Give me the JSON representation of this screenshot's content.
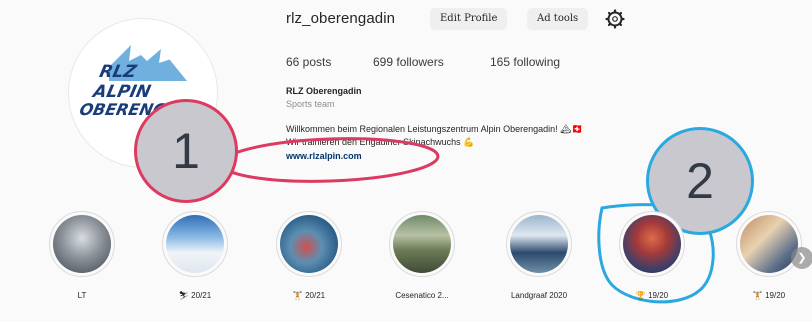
{
  "profile": {
    "username": "rlz_oberengadin",
    "edit_profile_label": "Edit Profile",
    "ad_tools_label": "Ad tools",
    "settings_icon": "gear-icon",
    "avatar_text": [
      "RLZ",
      "ALPIN",
      "OBERENGA"
    ]
  },
  "stats": {
    "posts": "66 posts",
    "followers": "699 followers",
    "following": "165 following"
  },
  "bio": {
    "name": "RLZ Oberengadin",
    "category": "Sports team",
    "line1": "Willkommen beim Regionalen Leistungszentrum Alpin Oberengadin! 🏔🇨🇭",
    "line2": "Wir trainieren den Engadiner Skinachwuchs 💪",
    "link": "www.rlzalpin.com"
  },
  "annotations": {
    "callout_1": "1",
    "callout_2": "2",
    "callout_1_color": "#dc3a60",
    "callout_2_color": "#29a9e0"
  },
  "highlights": [
    {
      "label": "LT"
    },
    {
      "label": "⛷ 20/21"
    },
    {
      "label": "🏋 20/21"
    },
    {
      "label": "Cesenatico 2..."
    },
    {
      "label": "Landgraaf 2020"
    },
    {
      "label": "🏆 19/20"
    },
    {
      "label": "🏋 19/20"
    }
  ],
  "scroll_icon": "chevron-right-icon"
}
